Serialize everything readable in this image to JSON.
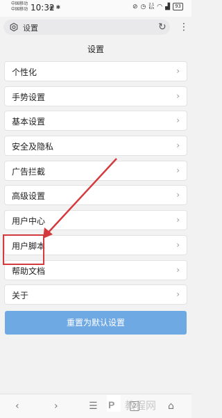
{
  "status_bar": {
    "carrier_1": "中国移动",
    "carrier_2": "中国移动",
    "time": "10:32",
    "net_speed_value": "2.1",
    "net_speed_unit": "K/s",
    "battery": "93"
  },
  "address_bar": {
    "text": "设置"
  },
  "page": {
    "title": "设置"
  },
  "settings": {
    "items": [
      {
        "label": "个性化"
      },
      {
        "label": "手势设置"
      },
      {
        "label": "基本设置"
      },
      {
        "label": "安全及隐私"
      },
      {
        "label": "广告拦截"
      },
      {
        "label": "高级设置"
      },
      {
        "label": "用户中心"
      },
      {
        "label": "用户脚本"
      },
      {
        "label": "帮助文档"
      },
      {
        "label": "关于"
      }
    ],
    "chevron": "›"
  },
  "reset_button": {
    "label": "重置为默认设置"
  },
  "toolbar": {
    "tab_count": "2"
  },
  "watermark": {
    "text": "PS 教程网"
  },
  "colors": {
    "accent": "#6fa9e4",
    "annotation": "#d33a3e"
  }
}
